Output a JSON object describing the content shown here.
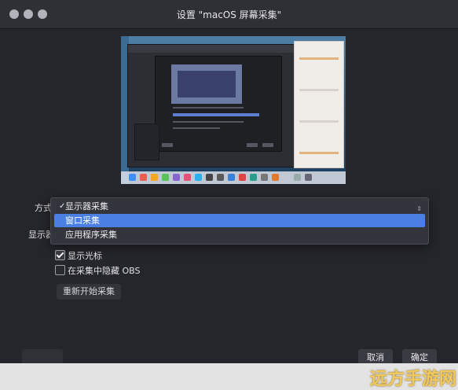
{
  "window": {
    "title": "设置 \"macOS 屏幕采集\""
  },
  "form": {
    "method_label": "方式",
    "display_label": "显示器",
    "capture_options": [
      {
        "label": "显示器采集",
        "checked": true,
        "highlighted": false
      },
      {
        "label": "窗口采集",
        "checked": false,
        "highlighted": true
      },
      {
        "label": "应用程序采集",
        "checked": false,
        "highlighted": false
      }
    ],
    "show_cursor_label": "显示光标",
    "show_cursor_checked": true,
    "hide_obs_label": "在采集中隐藏 OBS",
    "hide_obs_checked": false,
    "restart_button": "重新开始采集"
  },
  "buttons": {
    "cancel": "取消",
    "ok": "确定"
  },
  "watermark": {
    "text": "远方手游网"
  },
  "colors": {
    "accent": "#4a7fe4",
    "background": "#25262b"
  }
}
